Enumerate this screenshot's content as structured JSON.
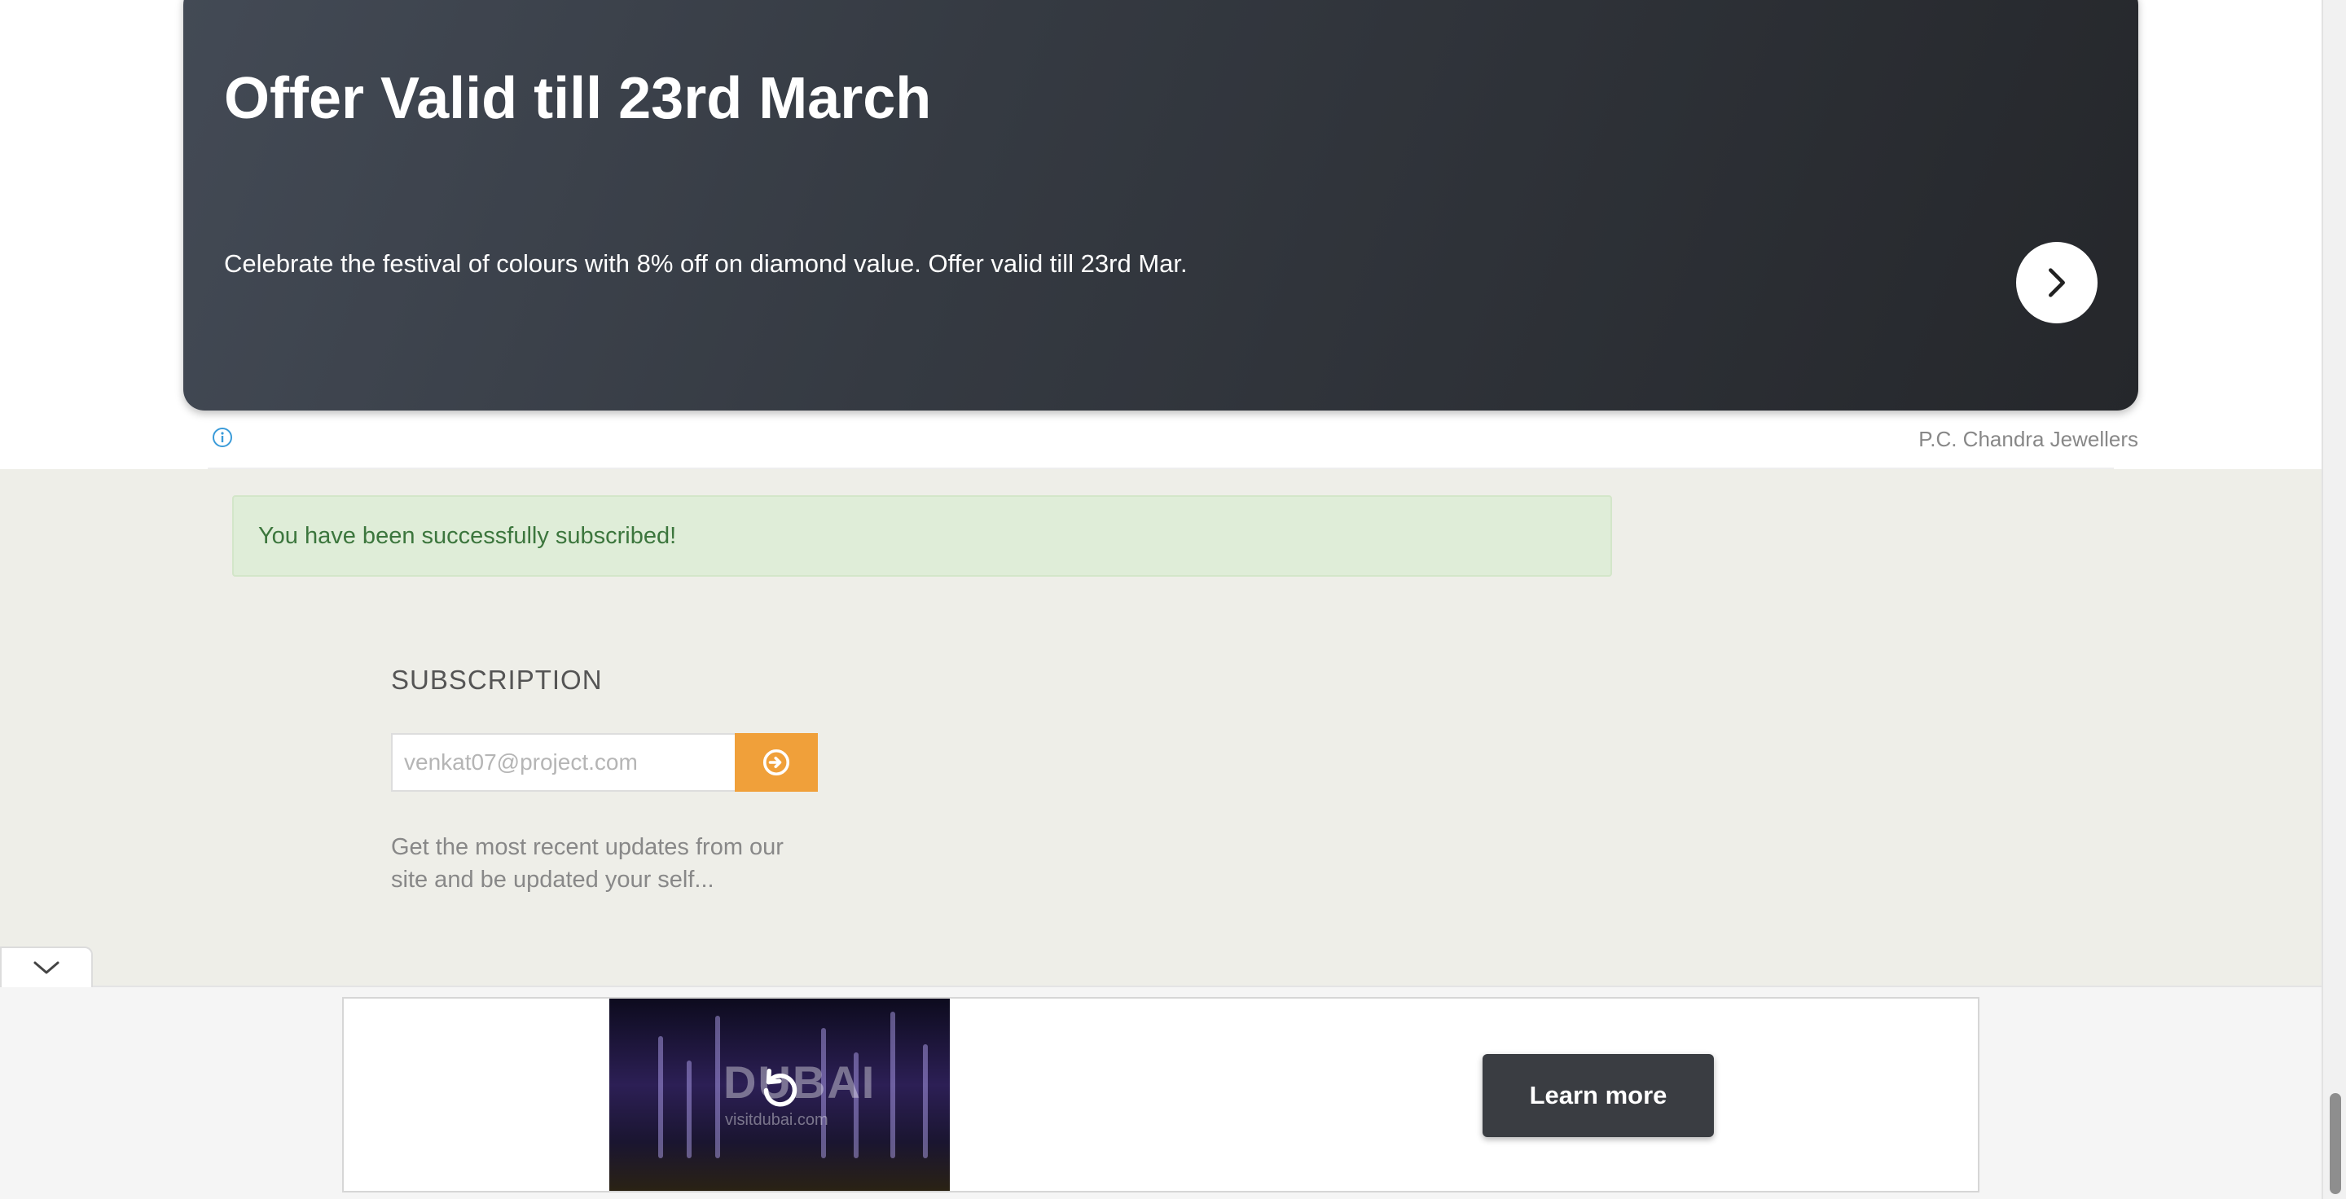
{
  "ad_banner": {
    "title": "Offer Valid till 23rd March",
    "description": "Celebrate the festival of colours with 8% off on diamond value. Offer valid till 23rd Mar.",
    "next_icon": "chevron-right-icon",
    "info_icon": "info-icon",
    "advertiser": "P.C. Chandra Jewellers"
  },
  "alert": {
    "message": "You have been successfully subscribed!"
  },
  "subscription": {
    "title": "SUBSCRIPTION",
    "email_value": "",
    "email_placeholder": "venkat07@project.com",
    "submit_icon": "arrow-circle-right-icon",
    "description": "Get the most recent updates from our site and be updated your self..."
  },
  "bottom_ad": {
    "collapse_icon": "chevron-down-icon",
    "video_logo": "DUBAI",
    "video_url": "visitdubai.com",
    "replay_icon": "replay-icon",
    "cta_label": "Learn more"
  },
  "colors": {
    "banner_dark": "#353a42",
    "content_background": "#eeeee8",
    "alert_background": "#dfedd8",
    "alert_text": "#3c763d",
    "submit_orange": "#f0a03a",
    "info_blue": "#3a9bd9",
    "cta_dark": "#3a3d42"
  }
}
